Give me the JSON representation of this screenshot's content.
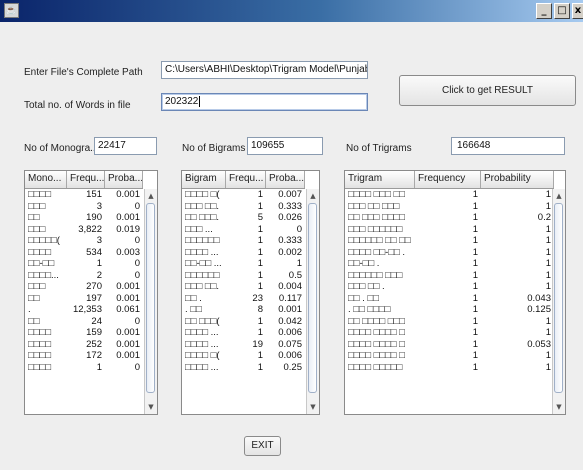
{
  "titlebar": {
    "buttons": {
      "minimize": "_",
      "maximize": "□",
      "close": "x"
    }
  },
  "file_path": {
    "label": "Enter File's Complete Path",
    "value": "C:\\Users\\ABHI\\Desktop\\Trigram Model\\Punjabi.txt"
  },
  "total_words": {
    "label": "Total no. of Words in file",
    "value": "202322"
  },
  "result_button": "Click to get RESULT",
  "counts": {
    "monograms_label": "No of Monogra...",
    "monograms_value": "22417",
    "bigrams_label": "No of Bigrams",
    "bigrams_value": "109655",
    "trigrams_label": "No of Trigrams",
    "trigrams_value": "166648"
  },
  "monogram_table": {
    "columns": [
      "Mono...",
      "Frequ...",
      "Proba..."
    ],
    "rows": [
      [
        "□□□□",
        "151",
        "0.001"
      ],
      [
        "□□□",
        "3",
        "0"
      ],
      [
        "□□",
        "190",
        "0.001"
      ],
      [
        "□□□",
        "3,822",
        "0.019"
      ],
      [
        "□□□□□(",
        "3",
        "0"
      ],
      [
        "□□□□",
        "534",
        "0.003"
      ],
      [
        "□□-□□",
        "1",
        "0"
      ],
      [
        "□□□□...",
        "2",
        "0"
      ],
      [
        "□□□",
        "270",
        "0.001"
      ],
      [
        "□□",
        "197",
        "0.001"
      ],
      [
        ".",
        "12,353",
        "0.061"
      ],
      [
        "□□",
        "24",
        "0"
      ],
      [
        "□□□□",
        "159",
        "0.001"
      ],
      [
        "□□□□",
        "252",
        "0.001"
      ],
      [
        "□□□□",
        "172",
        "0.001"
      ],
      [
        "□□□□",
        "1",
        "0"
      ]
    ]
  },
  "bigram_table": {
    "columns": [
      "Bigram",
      "Frequ...",
      "Proba..."
    ],
    "rows": [
      [
        "□□□□ □(",
        "1",
        "0.007"
      ],
      [
        "□□□ □□.",
        "1",
        "0.333"
      ],
      [
        "□□ □□□.",
        "5",
        "0.026"
      ],
      [
        "□□□ ...",
        "1",
        "0"
      ],
      [
        "□□□□□□",
        "1",
        "0.333"
      ],
      [
        "□□□□ ...",
        "1",
        "0.002"
      ],
      [
        "□□-□□ ...",
        "1",
        "1"
      ],
      [
        "□□□□□□",
        "1",
        "0.5"
      ],
      [
        "□□□ □□.",
        "1",
        "0.004"
      ],
      [
        "□□ .",
        "23",
        "0.117"
      ],
      [
        ". □□",
        "8",
        "0.001"
      ],
      [
        "□□ □□□(",
        "1",
        "0.042"
      ],
      [
        "□□□□ ...",
        "1",
        "0.006"
      ],
      [
        "□□□□ ...",
        "19",
        "0.075"
      ],
      [
        "□□□□ □(",
        "1",
        "0.006"
      ],
      [
        "□□□□ ...",
        "1",
        "0.25"
      ]
    ]
  },
  "trigram_table": {
    "columns": [
      "Trigram",
      "Frequency",
      "Probability"
    ],
    "rows": [
      [
        "□□□□ □□□ □□",
        "1",
        "1"
      ],
      [
        "□□□ □□ □□□",
        "1",
        "1"
      ],
      [
        "□□ □□□ □□□□",
        "1",
        "0.2"
      ],
      [
        "□□□ □□□□□□",
        "1",
        "1"
      ],
      [
        "□□□□□□ □□ □□",
        "1",
        "1"
      ],
      [
        "□□□□ □□-□□ .",
        "1",
        "1"
      ],
      [
        "□□-□□ .",
        "1",
        "1"
      ],
      [
        "□□□□□□ □□□",
        "1",
        "1"
      ],
      [
        "□□□ □□ .",
        "1",
        "1"
      ],
      [
        "□□ . □□",
        "1",
        "0.043"
      ],
      [
        ". □□ □□□□",
        "1",
        "0.125"
      ],
      [
        "□□ □□□□ □□□",
        "1",
        "1"
      ],
      [
        "□□□□ □□□□ □",
        "1",
        "1"
      ],
      [
        "□□□□ □□□□ □",
        "1",
        "0.053"
      ],
      [
        "□□□□ □□□□ □",
        "1",
        "1"
      ],
      [
        "□□□□ □□□□□",
        "1",
        "1"
      ]
    ]
  },
  "exit_button": "EXIT"
}
